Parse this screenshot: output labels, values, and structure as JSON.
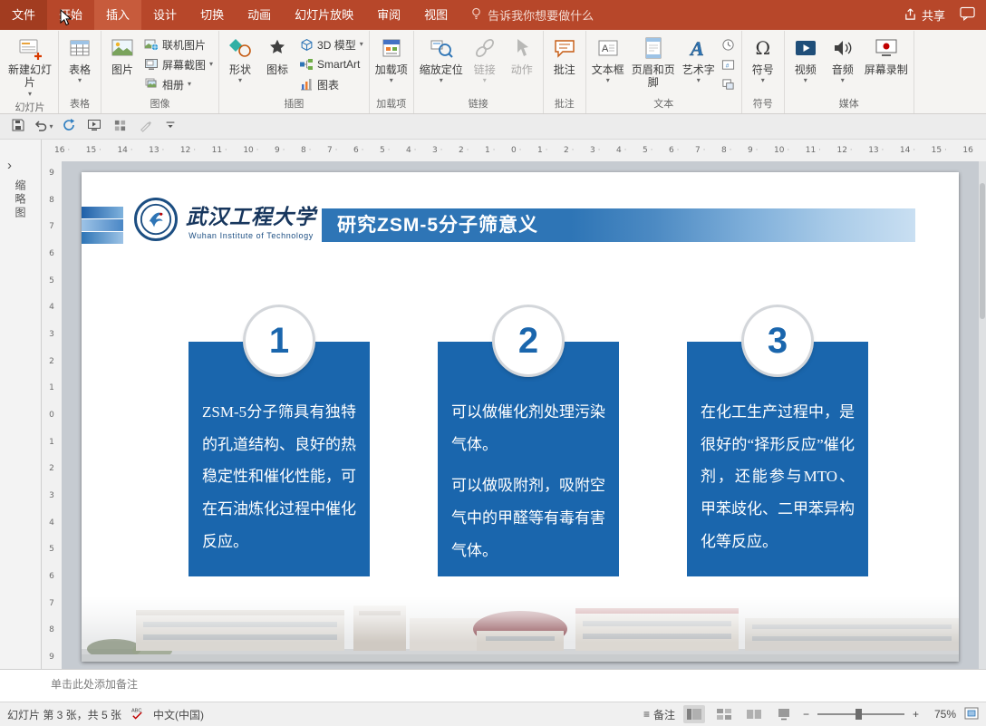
{
  "menubar": {
    "tabs": [
      "文件",
      "开始",
      "插入",
      "设计",
      "切换",
      "动画",
      "幻灯片放映",
      "审阅",
      "视图"
    ],
    "active_tab": "插入",
    "tell_me": "告诉我你想要做什么",
    "share": "共享"
  },
  "ribbon": {
    "groups": {
      "slides": "幻灯片",
      "tables": "表格",
      "images": "图像",
      "illustrations": "插图",
      "addins": "加载项",
      "links": "链接",
      "comments": "批注",
      "text": "文本",
      "symbols": "符号",
      "media": "媒体"
    },
    "buttons": {
      "new_slide": "新建幻灯片",
      "table": "表格",
      "picture": "图片",
      "online_pictures": "联机图片",
      "screenshot": "屏幕截图",
      "photo_album": "相册",
      "shapes": "形状",
      "icons": "图标",
      "model_3d": "3D 模型",
      "smartart": "SmartArt",
      "chart": "图表",
      "addins": "加载项",
      "zoom": "缩放定位",
      "link": "链接",
      "action": "动作",
      "comment": "批注",
      "text_box": "文本框",
      "header_footer": "页眉和页脚",
      "wordart": "艺术字",
      "symbol": "符号",
      "video": "视频",
      "audio": "音频",
      "screen_record": "屏幕录制"
    }
  },
  "glyphs": {
    "caret": "▾",
    "chevron": "›",
    "omega": "Ω",
    "menu": "≡",
    "minus": "−",
    "plus": "+"
  },
  "rulers": {
    "horizontal": [
      "16",
      "15",
      "14",
      "13",
      "12",
      "11",
      "10",
      "9",
      "8",
      "7",
      "6",
      "5",
      "4",
      "3",
      "2",
      "1",
      "0",
      "1",
      "2",
      "3",
      "4",
      "5",
      "6",
      "7",
      "8",
      "9",
      "10",
      "11",
      "12",
      "13",
      "14",
      "15",
      "16"
    ],
    "vertical": [
      "9",
      "8",
      "7",
      "6",
      "5",
      "4",
      "3",
      "2",
      "1",
      "0",
      "1",
      "2",
      "3",
      "4",
      "5",
      "6",
      "7",
      "8",
      "9"
    ]
  },
  "thumbnail_panel": {
    "label": "缩略图"
  },
  "slide": {
    "logo": {
      "name_cn": "武汉工程大学",
      "name_en": "Wuhan Institute of Technology"
    },
    "title": "研究ZSM-5分子筛意义",
    "cards": [
      {
        "number": "1",
        "paragraphs": [
          "ZSM-5分子筛具有独特的孔道结构、良好的热稳定性和催化性能，可在石油炼化过程中催化反应。"
        ]
      },
      {
        "number": "2",
        "paragraphs": [
          "可以做催化剂处理污染气体。",
          "可以做吸附剂，吸附空气中的甲醛等有毒有害气体。"
        ]
      },
      {
        "number": "3",
        "paragraphs": [
          "在化工生产过程中，是很好的“择形反应”催化剂，还能参与MTO、甲苯歧化、二甲苯异构化等反应。"
        ]
      }
    ]
  },
  "notes": {
    "placeholder": "单击此处添加备注"
  },
  "statusbar": {
    "slide_info": "幻灯片 第 3 张，共 5 张",
    "language": "中文(中国)",
    "notes_toggle": "备注",
    "zoom_level": "75%"
  },
  "colors": {
    "ribbon_accent": "#b7472a",
    "active_tab": "#c75b3c",
    "card_blue": "#1a66ad",
    "title_gradient_start": "#2e75b6",
    "title_gradient_end": "#c9dff2"
  }
}
